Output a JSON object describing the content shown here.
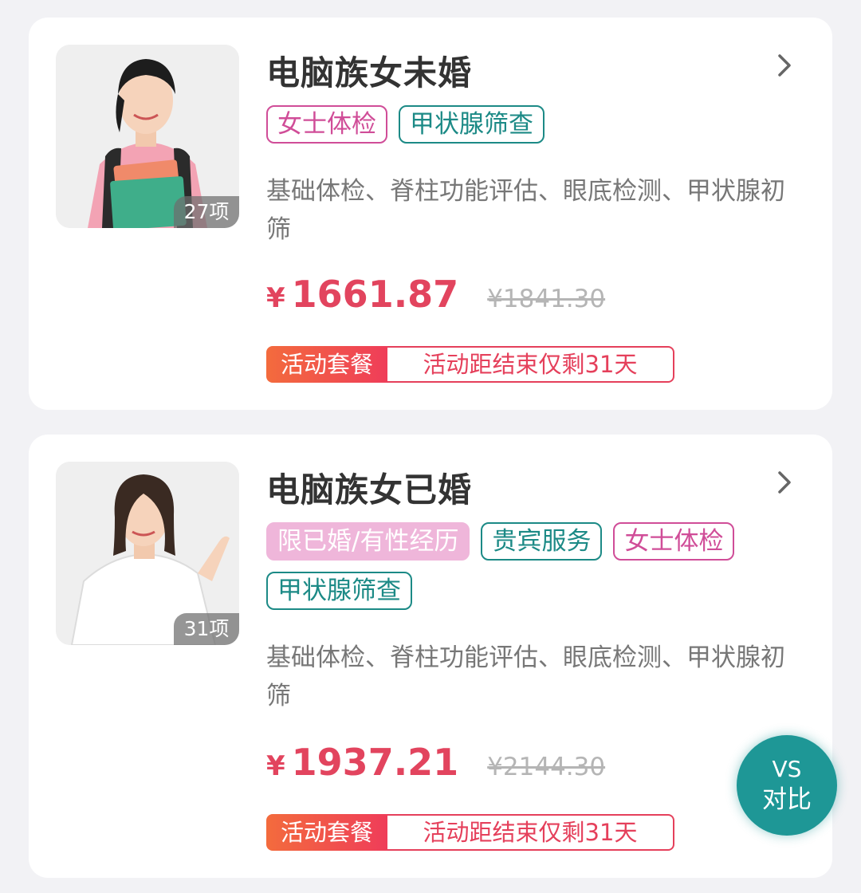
{
  "packages": [
    {
      "title": "电脑族女未婚",
      "item_count": "27项",
      "tags": [
        {
          "label": "女士体检",
          "style": "pink"
        },
        {
          "label": "甲状腺筛查",
          "style": "teal"
        }
      ],
      "description": "基础体检、脊柱功能评估、眼底检测、甲状腺初筛",
      "currency": "¥",
      "price": "1661.87",
      "original_price": "¥1841.30",
      "promo_label": "活动套餐",
      "promo_text": "活动距结束仅剩31天"
    },
    {
      "title": "电脑族女已婚",
      "item_count": "31项",
      "tags": [
        {
          "label": "限已婚/有性经历",
          "style": "filled"
        },
        {
          "label": "贵宾服务",
          "style": "teal"
        },
        {
          "label": "女士体检",
          "style": "pink"
        },
        {
          "label": "甲状腺筛查",
          "style": "teal"
        }
      ],
      "description": "基础体检、脊柱功能评估、眼底检测、甲状腺初筛",
      "currency": "¥",
      "price": "1937.21",
      "original_price": "¥2144.30",
      "promo_label": "活动套餐",
      "promo_text": "活动距结束仅剩31天"
    }
  ],
  "compare_button": {
    "line1": "VS",
    "line2": "对比"
  },
  "colors": {
    "price": "#e2445e",
    "tag_pink": "#d04d98",
    "tag_teal": "#1c8a86",
    "tag_filled_bg": "#efb6da",
    "compare_bg": "#1e9796"
  },
  "icons": {
    "chevron": "chevron-right-icon",
    "thumb_1": "young-woman-with-books-photo",
    "thumb_2": "woman-pointing-photo"
  }
}
